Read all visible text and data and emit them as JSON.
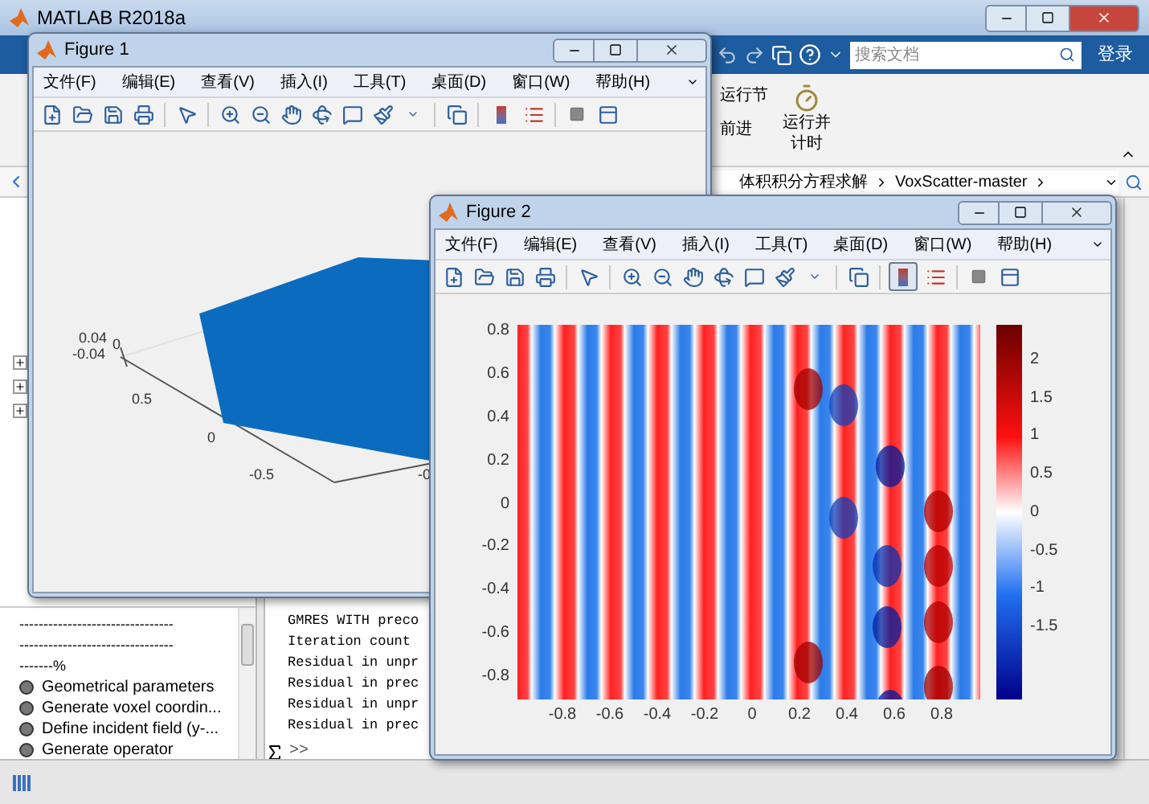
{
  "main_window": {
    "title": "MATLAB R2018a",
    "search": {
      "placeholder": "搜索文档"
    },
    "login_button": "登录",
    "ribbon": {
      "run_section": "运行节",
      "advance": "前进",
      "run_and_time": "运行并计时"
    },
    "address_path": [
      "体积积分方程求解",
      "VoxScatter-master"
    ]
  },
  "left_panel": {
    "outline_text": [
      "--------------------------------",
      "--------------------------------",
      "-------%"
    ],
    "outline_items": [
      "Geometrical parameters",
      "Generate voxel coordin...",
      "Define incident field (y-...",
      "Generate operator"
    ]
  },
  "command_window": {
    "lines": [
      "GMRES WITH preco",
      "Iteration count",
      "Residual in unpr",
      "Residual in prec",
      "Residual in unpr",
      "Residual in prec"
    ],
    "prompt": ">>"
  },
  "figures": [
    {
      "title": "Figure 1",
      "menu": [
        "文件(F)",
        "编辑(E)",
        "查看(V)",
        "插入(I)",
        "工具(T)",
        "桌面(D)",
        "窗口(W)",
        "帮助(H)"
      ],
      "colorbar_button_on": false,
      "plot": {
        "kind": "surface3d",
        "tick_labels": [
          "0.04",
          "0",
          "-0.04",
          "0.5",
          "0",
          "-0.5",
          "-0"
        ]
      }
    },
    {
      "title": "Figure 2",
      "menu": [
        "文件(F)",
        "编辑(E)",
        "查看(V)",
        "插入(I)",
        "工具(T)",
        "桌面(D)",
        "窗口(W)",
        "帮助(H)"
      ],
      "colorbar_button_on": true,
      "plot": {
        "kind": "field_map",
        "y_ticks": [
          "0.8",
          "0.6",
          "0.4",
          "0.2",
          "0",
          "-0.2",
          "-0.4",
          "-0.6",
          "-0.8"
        ],
        "x_ticks": [
          "-0.8",
          "-0.6",
          "-0.4",
          "-0.2",
          "0",
          "0.2",
          "0.4",
          "0.6",
          "0.8"
        ],
        "colorbar_ticks": [
          "2",
          "1.5",
          "1",
          "0.5",
          "0",
          "-0.5",
          "-1",
          "-1.5"
        ]
      }
    }
  ]
}
